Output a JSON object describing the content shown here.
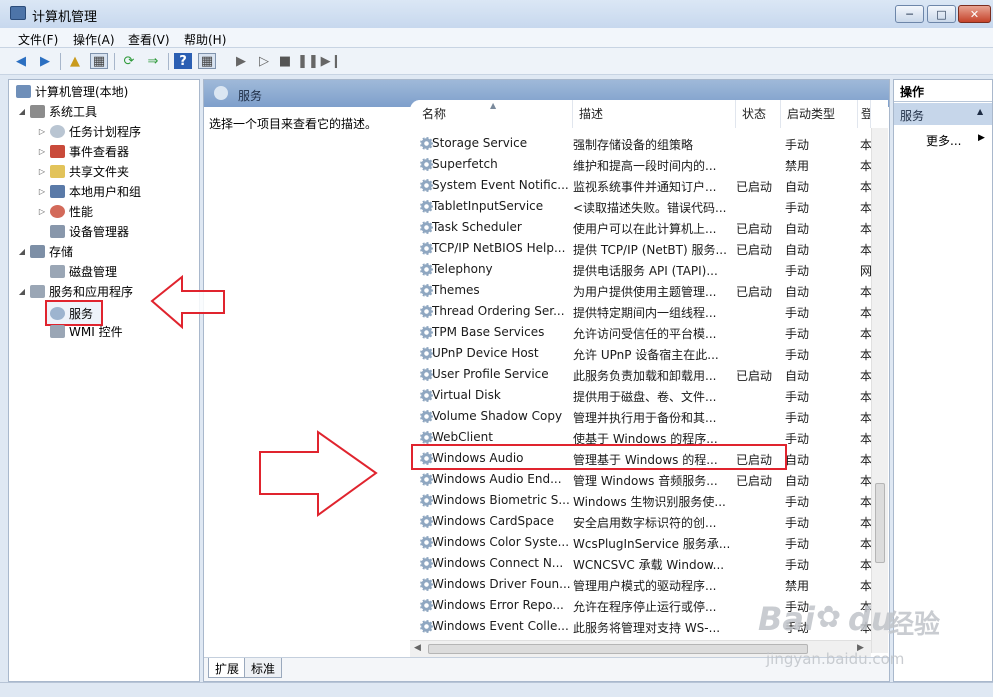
{
  "window": {
    "title": "计算机管理",
    "min_glyph": "─",
    "max_glyph": "□",
    "close_glyph": "✕"
  },
  "menu": [
    "文件(F)",
    "操作(A)",
    "查看(V)",
    "帮助(H)"
  ],
  "tree": {
    "root": "计算机管理(本地)",
    "items": [
      {
        "label": "系统工具",
        "icon": "tools-icon"
      },
      {
        "label": "任务计划程序",
        "icon": "clock-icon"
      },
      {
        "label": "事件查看器",
        "icon": "event-viewer-icon"
      },
      {
        "label": "共享文件夹",
        "icon": "shared-folder-icon"
      },
      {
        "label": "本地用户和组",
        "icon": "users-icon"
      },
      {
        "label": "性能",
        "icon": "performance-icon"
      },
      {
        "label": "设备管理器",
        "icon": "device-manager-icon"
      },
      {
        "label": "存储",
        "icon": "storage-icon"
      },
      {
        "label": "磁盘管理",
        "icon": "disk-icon"
      },
      {
        "label": "服务和应用程序",
        "icon": "services-apps-icon"
      },
      {
        "label": "服务",
        "icon": "gear-icon"
      },
      {
        "label": "WMI 控件",
        "icon": "wmi-icon"
      }
    ]
  },
  "center": {
    "header": "服务",
    "description_hint": "选择一个项目来查看它的描述。",
    "columns": [
      "名称",
      "描述",
      "状态",
      "启动类型",
      "登"
    ],
    "rows": [
      {
        "name": "Storage Service",
        "desc": "强制存储设备的组策略",
        "status": "",
        "startup": "手动",
        "logon": "本"
      },
      {
        "name": "Superfetch",
        "desc": "维护和提高一段时间内的...",
        "status": "",
        "startup": "禁用",
        "logon": "本"
      },
      {
        "name": "System Event Notific...",
        "desc": "监视系统事件并通知订户...",
        "status": "已启动",
        "startup": "自动",
        "logon": "本"
      },
      {
        "name": "TabletInputService",
        "desc": "<读取描述失败。错误代码...",
        "status": "",
        "startup": "手动",
        "logon": "本"
      },
      {
        "name": "Task Scheduler",
        "desc": "使用户可以在此计算机上...",
        "status": "已启动",
        "startup": "自动",
        "logon": "本"
      },
      {
        "name": "TCP/IP NetBIOS Help...",
        "desc": "提供 TCP/IP (NetBT) 服务...",
        "status": "已启动",
        "startup": "自动",
        "logon": "本"
      },
      {
        "name": "Telephony",
        "desc": "提供电话服务 API (TAPI)...",
        "status": "",
        "startup": "手动",
        "logon": "网"
      },
      {
        "name": "Themes",
        "desc": "为用户提供使用主题管理...",
        "status": "已启动",
        "startup": "自动",
        "logon": "本"
      },
      {
        "name": "Thread Ordering Ser...",
        "desc": "提供特定期间内一组线程...",
        "status": "",
        "startup": "手动",
        "logon": "本"
      },
      {
        "name": "TPM Base Services",
        "desc": "允许访问受信任的平台模...",
        "status": "",
        "startup": "手动",
        "logon": "本"
      },
      {
        "name": "UPnP Device Host",
        "desc": "允许 UPnP 设备宿主在此...",
        "status": "",
        "startup": "手动",
        "logon": "本"
      },
      {
        "name": "User Profile Service",
        "desc": "此服务负责加载和卸载用...",
        "status": "已启动",
        "startup": "自动",
        "logon": "本"
      },
      {
        "name": "Virtual Disk",
        "desc": "提供用于磁盘、卷、文件...",
        "status": "",
        "startup": "手动",
        "logon": "本"
      },
      {
        "name": "Volume Shadow Copy",
        "desc": "管理并执行用于备份和其...",
        "status": "",
        "startup": "手动",
        "logon": "本"
      },
      {
        "name": "WebClient",
        "desc": "使基于 Windows 的程序...",
        "status": "",
        "startup": "手动",
        "logon": "本"
      },
      {
        "name": "Windows Audio",
        "desc": "管理基于 Windows 的程...",
        "status": "已启动",
        "startup": "自动",
        "logon": "本"
      },
      {
        "name": "Windows Audio End...",
        "desc": "管理 Windows 音频服务...",
        "status": "已启动",
        "startup": "自动",
        "logon": "本"
      },
      {
        "name": "Windows Biometric S...",
        "desc": "Windows 生物识别服务使...",
        "status": "",
        "startup": "手动",
        "logon": "本"
      },
      {
        "name": "Windows CardSpace",
        "desc": "安全启用数字标识符的创...",
        "status": "",
        "startup": "手动",
        "logon": "本"
      },
      {
        "name": "Windows Color Syste...",
        "desc": "WcsPlugInService 服务承...",
        "status": "",
        "startup": "手动",
        "logon": "本"
      },
      {
        "name": "Windows Connect N...",
        "desc": "WCNCSVC 承载 Window...",
        "status": "",
        "startup": "手动",
        "logon": "本"
      },
      {
        "name": "Windows Driver Foun...",
        "desc": "管理用户模式的驱动程序...",
        "status": "",
        "startup": "禁用",
        "logon": "本"
      },
      {
        "name": "Windows Error Repo...",
        "desc": "允许在程序停止运行或停...",
        "status": "",
        "startup": "手动",
        "logon": "本"
      },
      {
        "name": "Windows Event Colle...",
        "desc": "此服务将管理对支持 WS-...",
        "status": "",
        "startup": "手动",
        "logon": "本"
      }
    ],
    "tabs": [
      "扩展",
      "标准"
    ]
  },
  "actions": {
    "title": "操作",
    "section": "服务",
    "more": "更多..."
  },
  "watermark": {
    "brand": "Bai",
    "du": "du",
    "cn": "经验",
    "url": "jingyan.baidu.com"
  },
  "colors": {
    "highlight_box": "#e0242e",
    "header_blue": "#7e9fcb"
  }
}
